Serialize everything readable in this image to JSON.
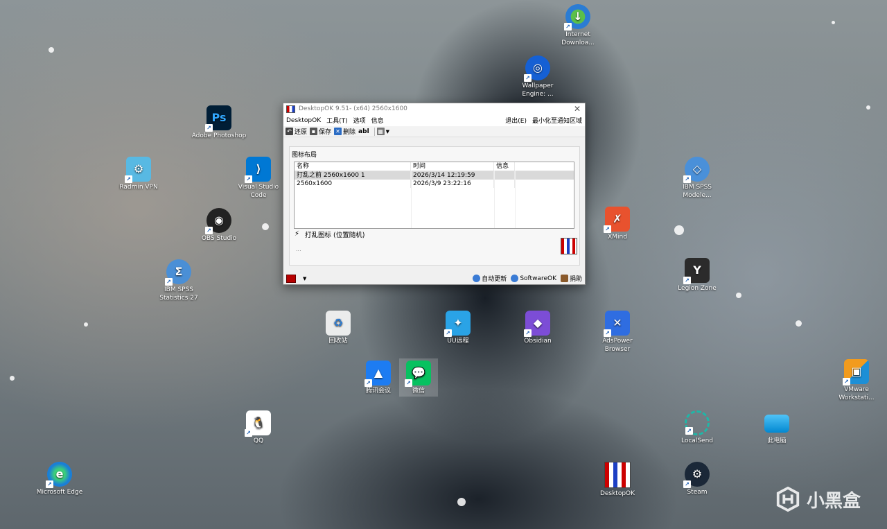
{
  "desktop_icons": {
    "idm": "Internet Downloa...",
    "wallpaper_engine": "Wallpaper Engine: ...",
    "photoshop": "Adobe Photoshop",
    "radmin": "Radmin VPN",
    "vscode": "Visual Studio Code",
    "obs": "OBS Studio",
    "spss": "IBM SPSS Statistics 27",
    "recycle_bin": "回收站",
    "uu": "UU远程",
    "obsidian": "Obsidian",
    "adspower": "AdsPower Browser",
    "tencent_meeting": "腾讯会议",
    "wechat": "微信",
    "qq": "QQ",
    "edge": "Microsoft Edge",
    "ibm_modeler": "IBM SPSS Modele...",
    "xmind": "XMind",
    "legion_zone": "Legion Zone",
    "vmware": "VMware Workstati...",
    "localsend": "LocalSend",
    "this_pc": "此电脑",
    "desktopok": "DesktopOK",
    "steam": "Steam"
  },
  "window": {
    "title": "DesktopOK 9.51- (x64) 2560x1600",
    "menu": {
      "desktopok": "DesktopOK",
      "tools": "工具(T)",
      "options": "选项",
      "info": "信息",
      "exit": "退出(E)",
      "minimize_tray": "最小化至通知区域"
    },
    "toolbar": {
      "restore": "还原",
      "save": "保存",
      "delete": "删除",
      "abl": "abl"
    },
    "group_label": "图标布局",
    "columns": [
      "名称",
      "时间",
      "信息"
    ],
    "rows": [
      {
        "name": "打乱之前 2560x1600 1",
        "time": "2026/3/14 12:19:59",
        "info": ""
      },
      {
        "name": "2560x1600",
        "time": "2026/3/9 23:22:16",
        "info": ""
      }
    ],
    "shuffle_label": "打乱图标 (位置随机)",
    "dots": "...",
    "status": {
      "auto_update": "自动更新",
      "softwareok": "SoftwareOK",
      "donate": "捐助"
    }
  },
  "watermark": "小黑盒"
}
